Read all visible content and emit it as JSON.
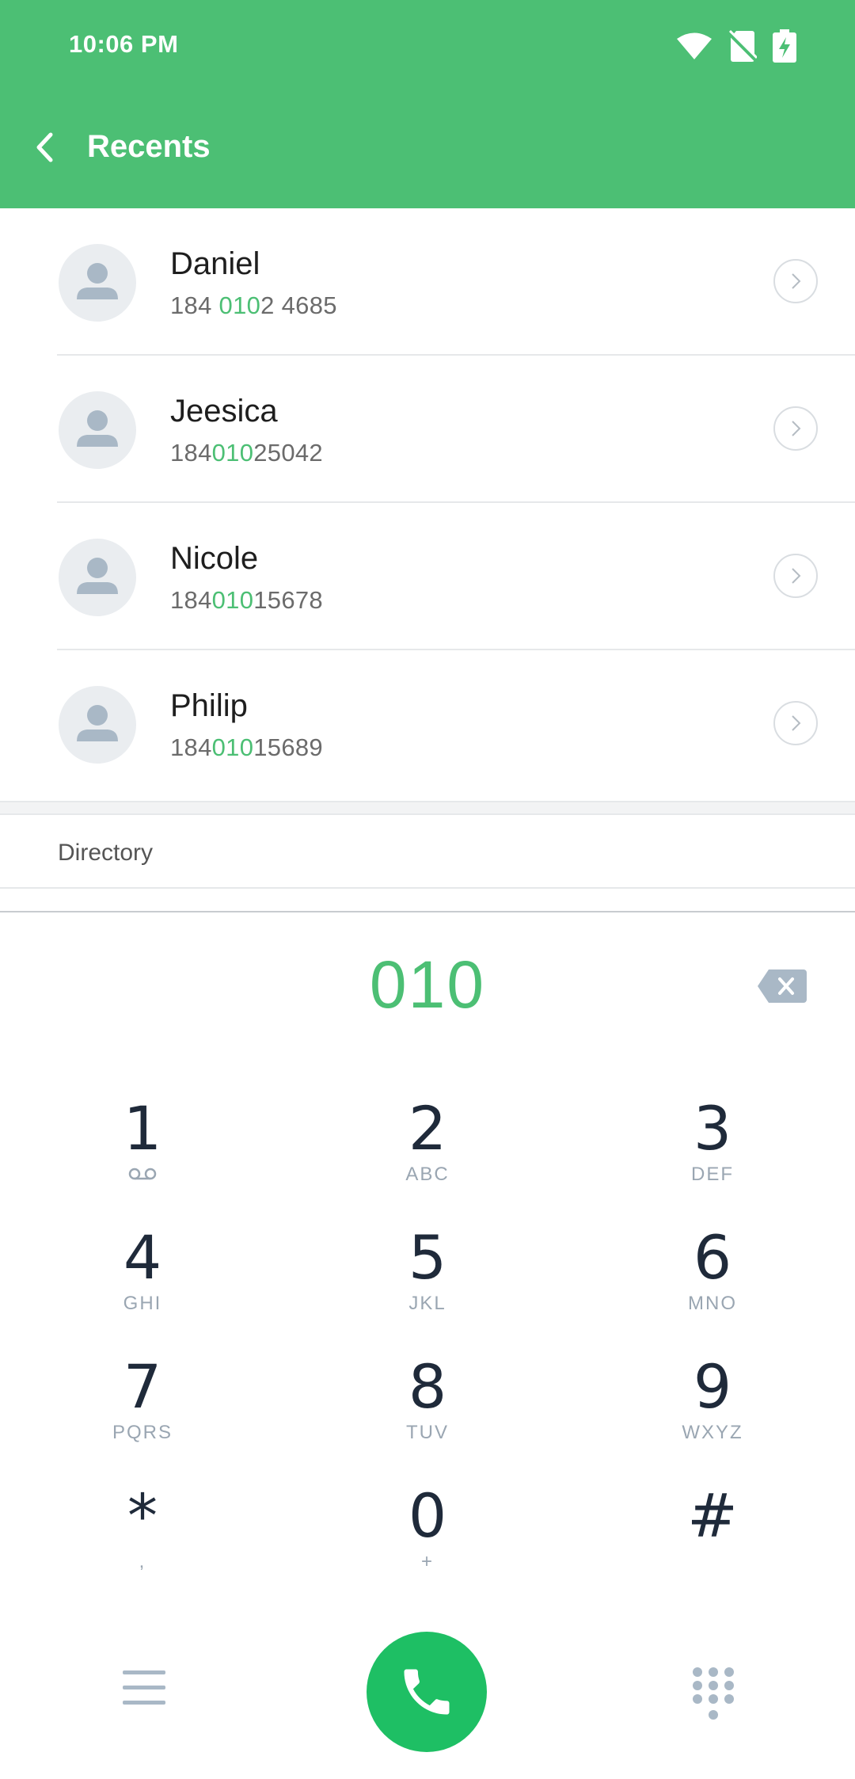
{
  "status_bar": {
    "time": "10:06 PM"
  },
  "header": {
    "title": "Recents"
  },
  "contacts": [
    {
      "name": "Daniel",
      "number_pre": "184 ",
      "number_match": "010",
      "number_post": "2 4685"
    },
    {
      "name": "Jeesica",
      "number_pre": "184",
      "number_match": "010",
      "number_post": "25042"
    },
    {
      "name": "Nicole",
      "number_pre": "184",
      "number_match": "010",
      "number_post": "15678"
    },
    {
      "name": "Philip",
      "number_pre": "184",
      "number_match": "010",
      "number_post": "15689"
    }
  ],
  "directory_label": "Directory",
  "dial_entry": "010",
  "keypad": [
    {
      "digit": "1",
      "letters": ""
    },
    {
      "digit": "2",
      "letters": "ABC"
    },
    {
      "digit": "3",
      "letters": "DEF"
    },
    {
      "digit": "4",
      "letters": "GHI"
    },
    {
      "digit": "5",
      "letters": "JKL"
    },
    {
      "digit": "6",
      "letters": "MNO"
    },
    {
      "digit": "7",
      "letters": "PQRS"
    },
    {
      "digit": "8",
      "letters": "TUV"
    },
    {
      "digit": "9",
      "letters": "WXYZ"
    },
    {
      "digit": "*",
      "letters": ","
    },
    {
      "digit": "0",
      "letters": "+"
    },
    {
      "digit": "#",
      "letters": ""
    }
  ],
  "colors": {
    "accent": "#4cbf74",
    "call_button": "#1ebf64",
    "digit": "#1f2a3a",
    "letters": "#9aa6b2"
  },
  "icons": {
    "back": "chevron-left-icon",
    "wifi": "wifi-icon",
    "sim": "no-sim-icon",
    "battery": "battery-charging-icon",
    "avatar": "person-icon",
    "details": "chevron-right-circle-icon",
    "backspace": "backspace-icon",
    "voicemail": "voicemail-icon",
    "menu": "menu-icon",
    "call": "phone-icon",
    "dialpad": "dialpad-icon"
  }
}
